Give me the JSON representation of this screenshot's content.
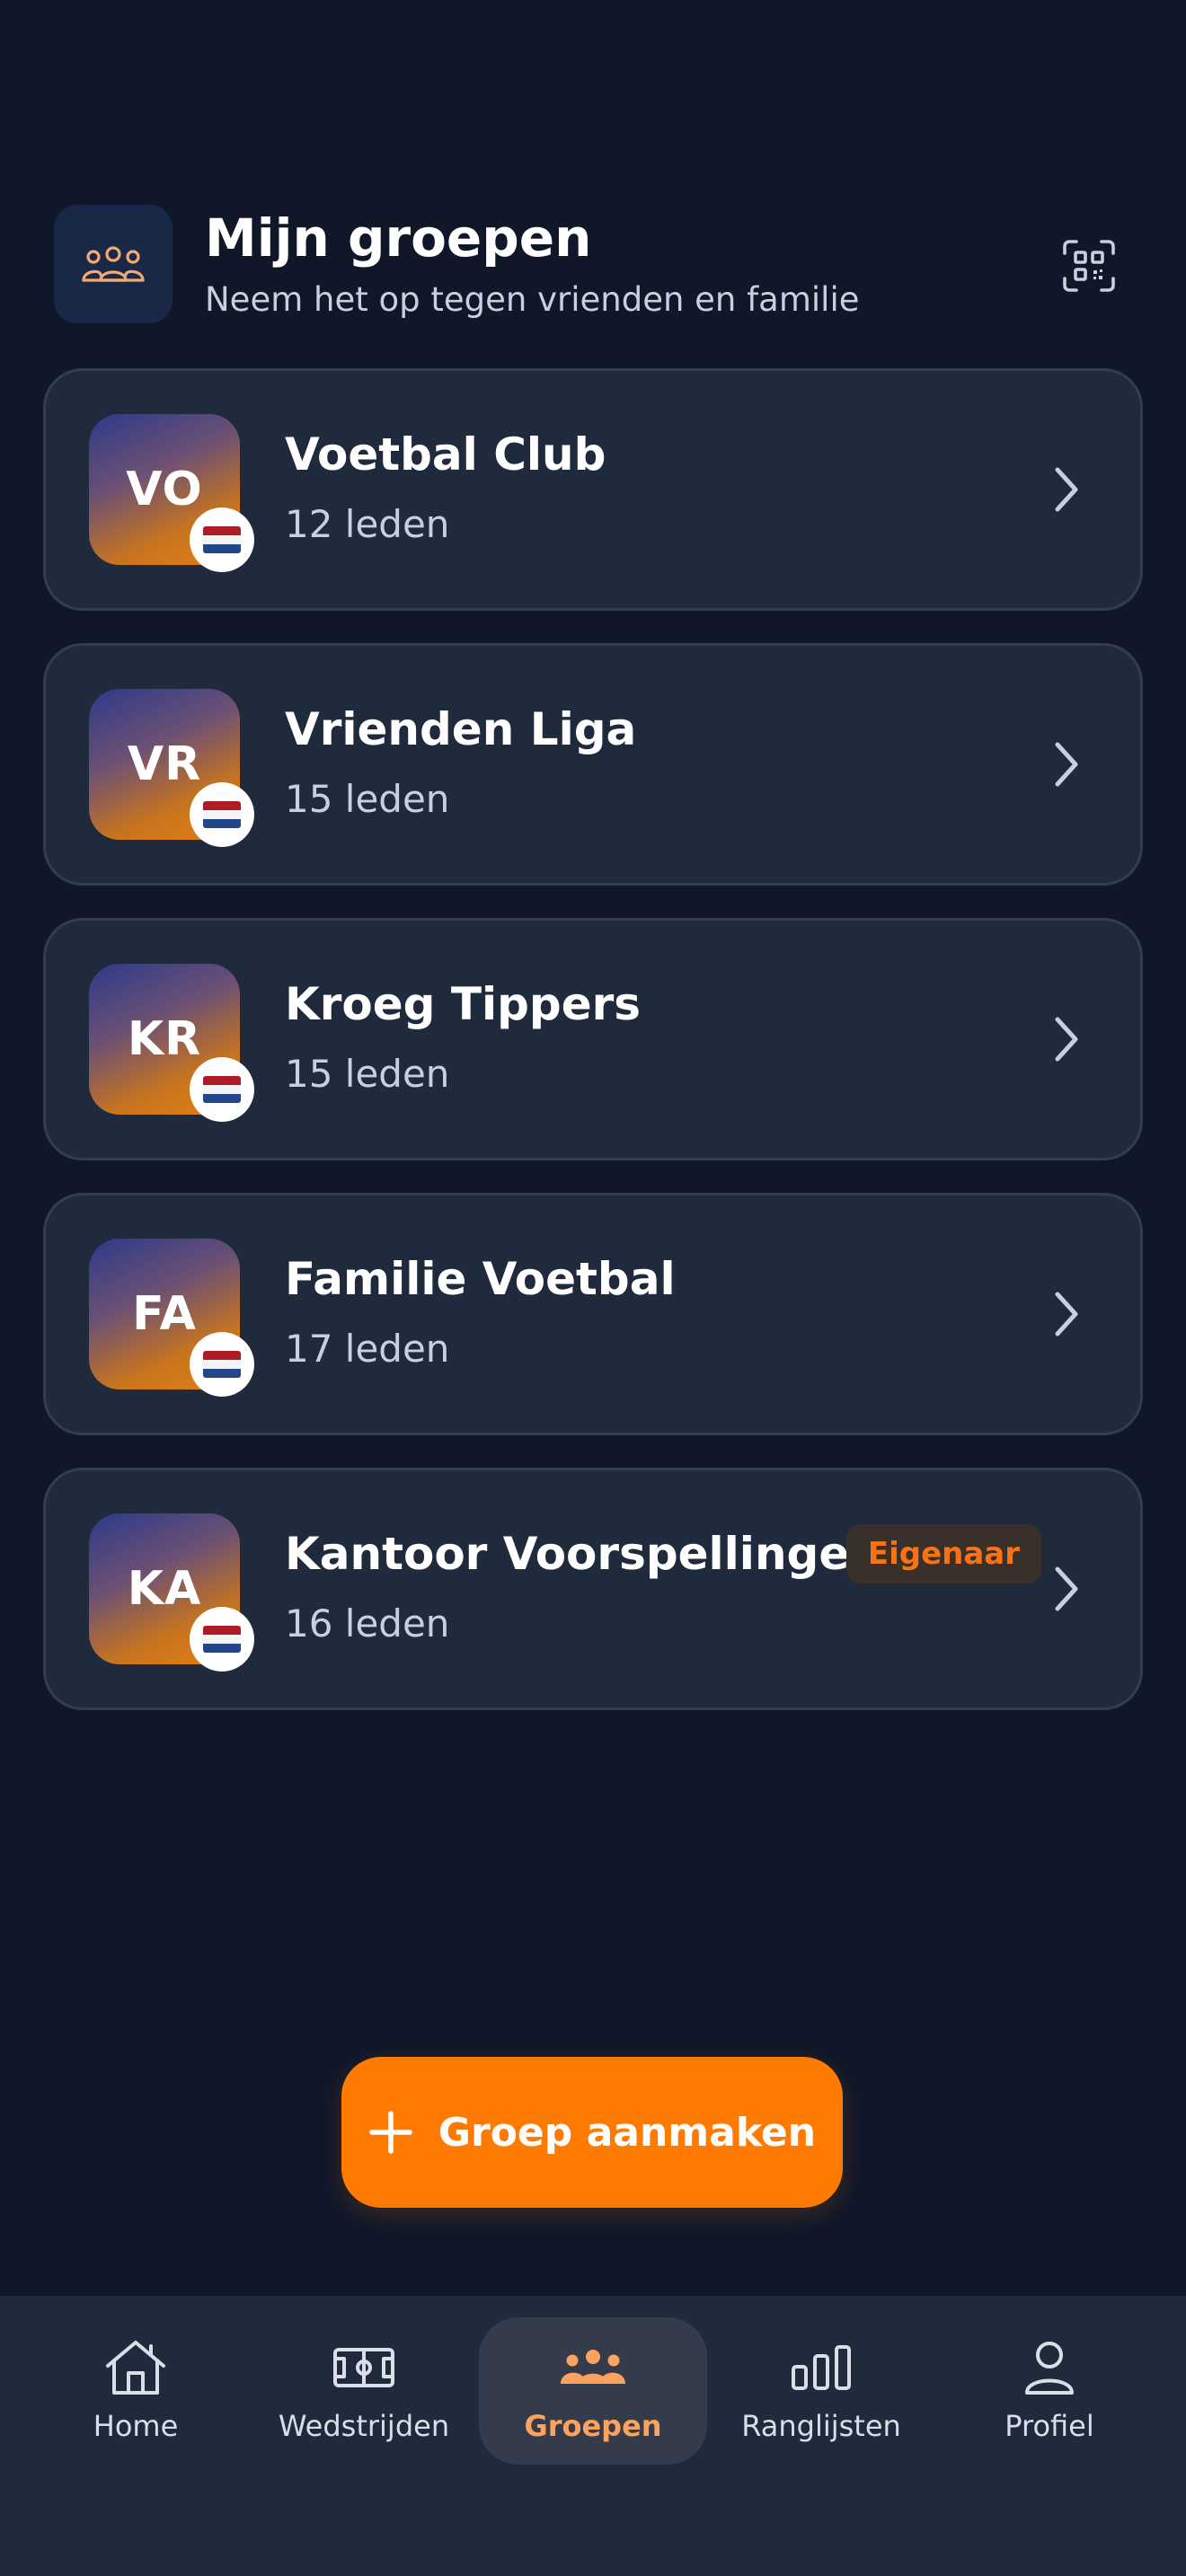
{
  "header": {
    "icon": "users-icon",
    "title": "Mijn groepen",
    "subtitle": "Neem het op tegen vrienden en familie",
    "qr_icon": "qr-code-icon"
  },
  "groups": [
    {
      "initials": "VO",
      "name": "Voetbal Club",
      "members": "12 leden",
      "flag": "netherlands-flag-icon"
    },
    {
      "initials": "VR",
      "name": "Vrienden Liga",
      "members": "15 leden",
      "flag": "netherlands-flag-icon"
    },
    {
      "initials": "KR",
      "name": "Kroeg Tippers",
      "members": "15 leden",
      "flag": "netherlands-flag-icon"
    },
    {
      "initials": "FA",
      "name": "Familie Voetbal",
      "members": "17 leden",
      "flag": "netherlands-flag-icon"
    },
    {
      "initials": "KA",
      "name": "Kantoor Voorspellingen",
      "members": "16 leden",
      "flag": "netherlands-flag-icon",
      "badge": "Eigenaar"
    }
  ],
  "create_button": {
    "icon": "plus-icon",
    "label": "Groep aanmaken"
  },
  "nav": {
    "active": "Groepen",
    "items": [
      {
        "label": "Home",
        "icon": "home-icon"
      },
      {
        "label": "Wedstrijden",
        "icon": "football-field-icon"
      },
      {
        "label": "Groepen",
        "icon": "users-icon"
      },
      {
        "label": "Ranglijsten",
        "icon": "bar-chart-icon"
      },
      {
        "label": "Profiel",
        "icon": "user-icon"
      }
    ]
  },
  "colors": {
    "background": "#0f1729",
    "card": "#1f2a3d",
    "accent": "#ff7a00",
    "accent_light": "#fba35e",
    "muted_text": "#c8cfdd"
  }
}
